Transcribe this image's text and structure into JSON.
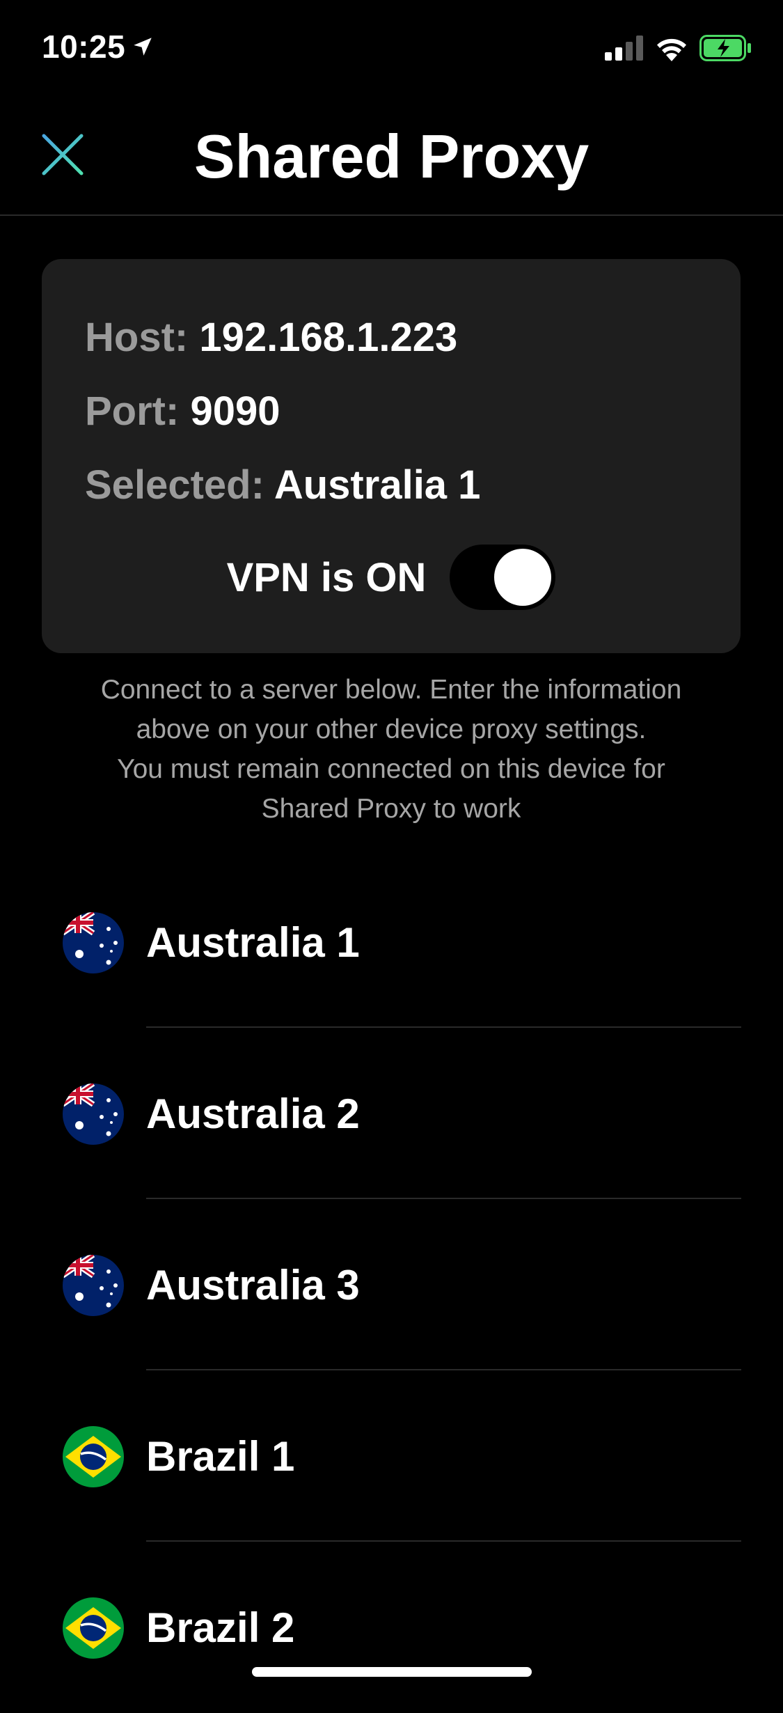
{
  "status_bar": {
    "time": "10:25",
    "location_icon": "location-arrow-icon",
    "signal_icon": "cellular-signal-icon",
    "wifi_icon": "wifi-icon",
    "battery_icon": "battery-charging-icon",
    "battery_color": "#4cd964"
  },
  "nav": {
    "title": "Shared Proxy",
    "close_icon": "close-icon",
    "close_color": "#46c8c8"
  },
  "proxy_info": {
    "host_label": "Host:",
    "host_value": "192.168.1.223",
    "port_label": "Port:",
    "port_value": "9090",
    "selected_label": "Selected:",
    "selected_value": "Australia 1",
    "vpn_label": "VPN is ON",
    "vpn_on": true
  },
  "helper": {
    "lines": [
      "Connect to a server below. Enter the information",
      "above on your other device proxy settings.",
      "You must remain connected on this device for",
      "Shared Proxy to work"
    ]
  },
  "servers": [
    {
      "name": "Australia 1",
      "flag": "australia-flag-icon"
    },
    {
      "name": "Australia 2",
      "flag": "australia-flag-icon"
    },
    {
      "name": "Australia 3",
      "flag": "australia-flag-icon"
    },
    {
      "name": "Brazil 1",
      "flag": "brazil-flag-icon"
    },
    {
      "name": "Brazil 2",
      "flag": "brazil-flag-icon"
    }
  ],
  "colors": {
    "background": "#000000",
    "card": "#1e1e1e",
    "label_gray": "#9b9b9b",
    "helper_gray": "#a6a6a6"
  }
}
